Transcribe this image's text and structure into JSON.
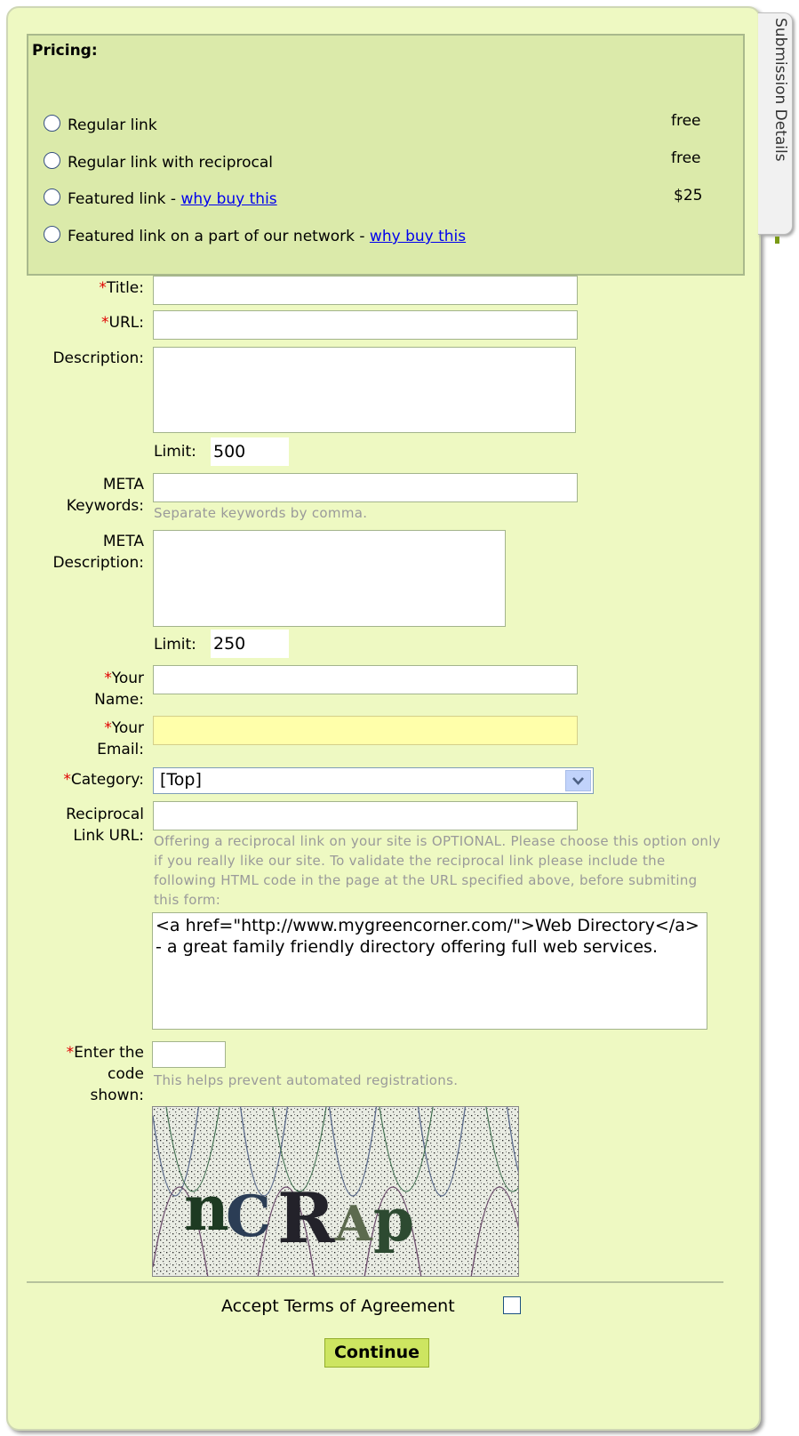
{
  "side_tab": {
    "label": "Submission Details"
  },
  "pricing": {
    "title": "Pricing:",
    "options": [
      {
        "label": "Regular link",
        "price": "free"
      },
      {
        "label": "Regular link with reciprocal",
        "price": "free"
      },
      {
        "label": "Featured link - ",
        "link": "why buy this",
        "price": "$25"
      },
      {
        "label": "Featured link on a part of our network - ",
        "link": "why buy this",
        "price": ""
      }
    ]
  },
  "form": {
    "required_mark": "*",
    "title": {
      "label": "Title:",
      "value": ""
    },
    "url": {
      "label": "URL:",
      "value": ""
    },
    "description": {
      "label": "Description:",
      "value": "",
      "limit_label": "Limit:",
      "limit_value": "500"
    },
    "meta_keywords": {
      "label_line1": "META",
      "label_line2": "Keywords:",
      "value": "",
      "hint": "Separate keywords by comma."
    },
    "meta_description": {
      "label_line1": "META",
      "label_line2": "Description:",
      "value": "",
      "limit_label": "Limit:",
      "limit_value": "250"
    },
    "your_name": {
      "label_line1": "Your",
      "label_line2": "Name:",
      "value": ""
    },
    "your_email": {
      "label_line1": "Your",
      "label_line2": "Email:",
      "value": "",
      "highlight_color": "#ffffaa"
    },
    "category": {
      "label": "Category:",
      "selected": "[Top]"
    },
    "reciprocal": {
      "label_line1": "Reciprocal",
      "label_line2": "Link URL:",
      "value": "",
      "hint": "Offering a reciprocal link on your site is OPTIONAL. Please choose this option only if you really like our site. To validate the reciprocal link please include the following HTML code in the page at the URL specified above, before submiting this form:",
      "code": "<a href=\"http://www.mygreencorner.com/\">Web Directory</a> - a great family friendly directory offering full web services."
    },
    "captcha": {
      "label_line1": "Enter the",
      "label_line2": "code",
      "label_line3": "shown:",
      "value": "",
      "hint": "This helps prevent automated registrations.",
      "image_text": "nCRAp"
    },
    "terms": {
      "label": "Accept Terms of Agreement",
      "checked": false
    },
    "submit_label": "Continue"
  },
  "colors": {
    "panel_bg": "#eef9c2",
    "pricing_bg": "#dbeaaa",
    "button_bg": "#cde561",
    "required": "#e00000",
    "link": "#0000ee"
  }
}
